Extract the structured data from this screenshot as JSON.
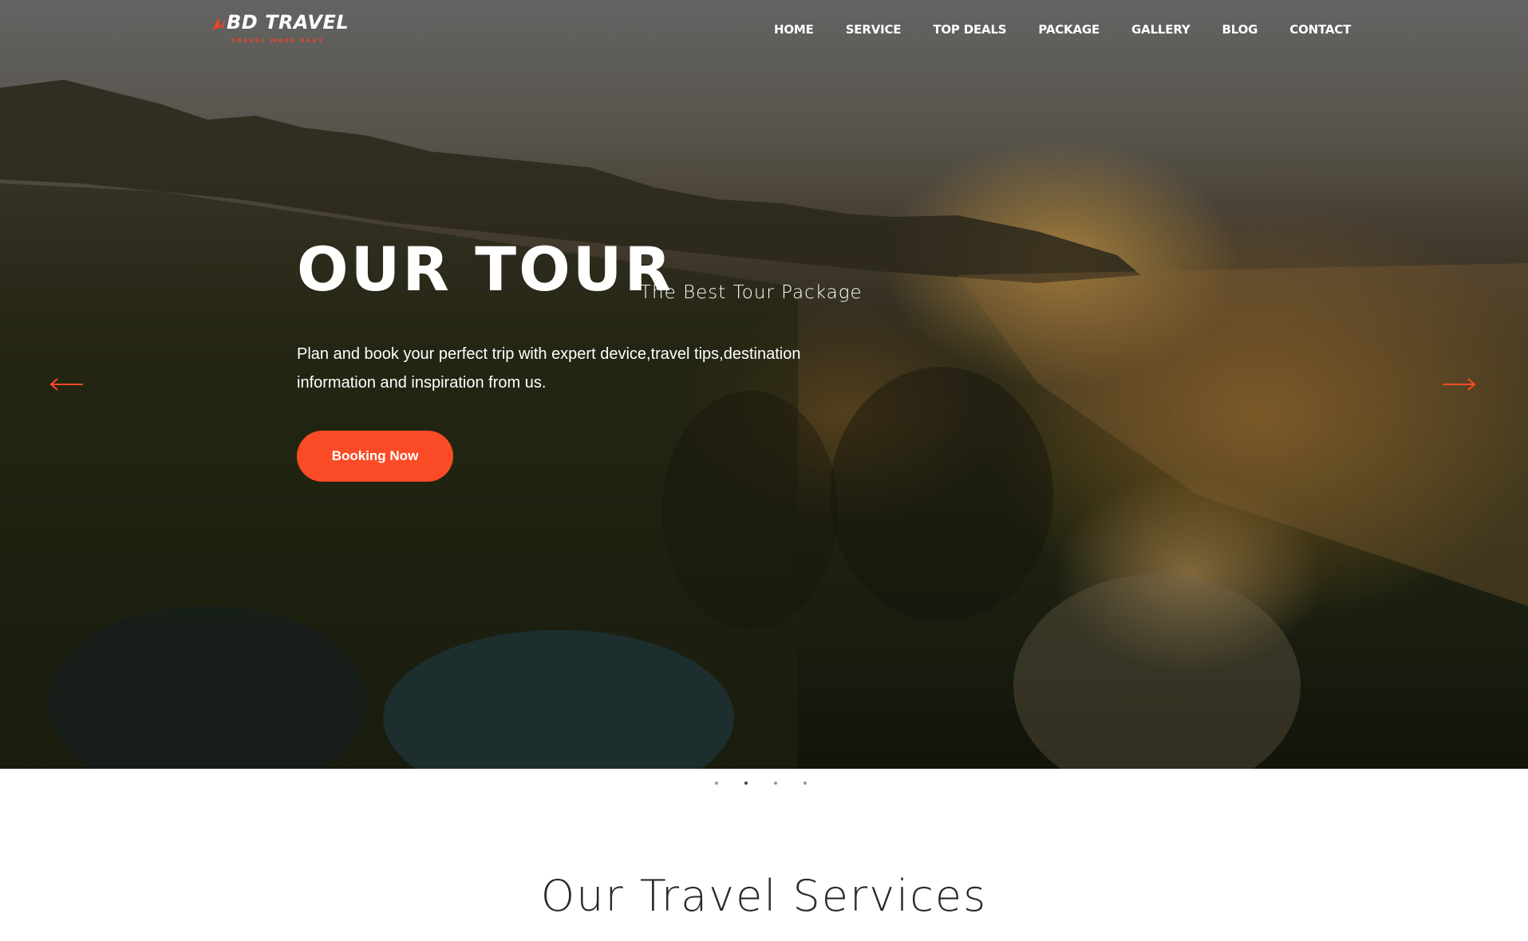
{
  "brand": {
    "name": "BD TRAVEL",
    "tagline": "TRAVEL MADE EASY",
    "accent_color": "#fb4a26"
  },
  "nav": {
    "items": [
      {
        "label": "HOME"
      },
      {
        "label": "SERVICE"
      },
      {
        "label": "TOP DEALS"
      },
      {
        "label": "PACKAGE"
      },
      {
        "label": "GALLERY"
      },
      {
        "label": "BLOG"
      },
      {
        "label": "CONTACT"
      }
    ]
  },
  "hero": {
    "title": "OUR TOUR",
    "subtitle": "The Best Tour Package",
    "description": "Plan and book your perfect trip with expert device,travel tips,destination information and inspiration from us.",
    "cta_label": "Booking Now",
    "prev_icon": "arrow-left-icon",
    "next_icon": "arrow-right-icon"
  },
  "slider": {
    "slide_count": 4,
    "active_index": 1
  },
  "services": {
    "title": "Our Travel Services"
  }
}
